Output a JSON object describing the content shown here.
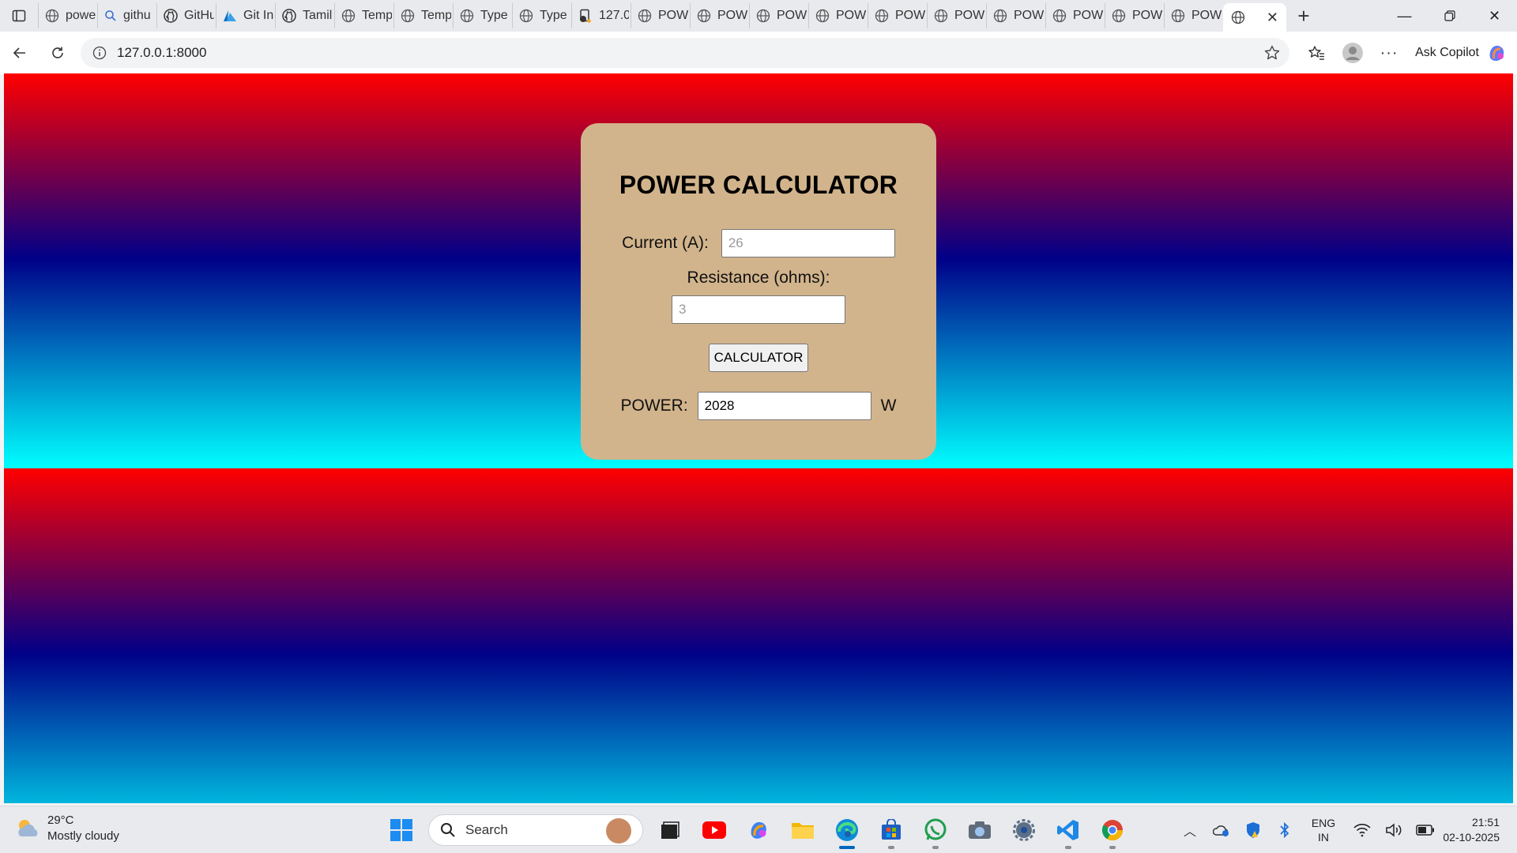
{
  "browser": {
    "tabs": [
      {
        "title": "powe",
        "icon": "globe-icon"
      },
      {
        "title": "githu",
        "icon": "search-icon"
      },
      {
        "title": "GitHu",
        "icon": "github-icon"
      },
      {
        "title": "Git In",
        "icon": "azure-icon"
      },
      {
        "title": "Tamil",
        "icon": "github-icon"
      },
      {
        "title": "Temp",
        "icon": "globe-icon"
      },
      {
        "title": "Temp",
        "icon": "globe-icon"
      },
      {
        "title": "Type",
        "icon": "globe-icon"
      },
      {
        "title": "Type",
        "icon": "globe-icon"
      },
      {
        "title": "127.0",
        "icon": "page-icon"
      },
      {
        "title": "POW",
        "icon": "globe-icon"
      },
      {
        "title": "POW",
        "icon": "globe-icon"
      },
      {
        "title": "POW",
        "icon": "globe-icon"
      },
      {
        "title": "POW",
        "icon": "globe-icon"
      },
      {
        "title": "POW",
        "icon": "globe-icon"
      },
      {
        "title": "POW",
        "icon": "globe-icon"
      },
      {
        "title": "POW",
        "icon": "globe-icon"
      },
      {
        "title": "POW",
        "icon": "globe-icon"
      },
      {
        "title": "POW",
        "icon": "globe-icon"
      },
      {
        "title": "POW",
        "icon": "globe-icon"
      }
    ],
    "active_tab_icon": "globe-icon",
    "url": "127.0.0.1:8000",
    "copilot_label": "Ask Copilot"
  },
  "page": {
    "title": "POWER CALCULATOR",
    "current_label": "Current (A):",
    "current_placeholder": "26",
    "resistance_label": "Resistance (ohms):",
    "resistance_placeholder": "3",
    "button_label": "CALCULATOR",
    "power_label": "POWER:",
    "power_value": "2028",
    "power_unit": "W",
    "colors": {
      "card": "#d2b48c",
      "gradient_top": "#ff0000",
      "gradient_mid": "#000088",
      "gradient_bottom": "#00ffff"
    }
  },
  "taskbar": {
    "weather_temp": "29°C",
    "weather_desc": "Mostly cloudy",
    "search_label": "Search",
    "apps": [
      "file-explorer-black-icon",
      "youtube-icon",
      "copilot-icon",
      "folder-icon",
      "edge-icon",
      "store-icon",
      "whatsapp-icon",
      "camera-icon",
      "settings-icon",
      "vscode-icon",
      "chrome-icon"
    ],
    "lang_top": "ENG",
    "lang_bottom": "IN",
    "time": "21:51",
    "date": "02-10-2025"
  }
}
